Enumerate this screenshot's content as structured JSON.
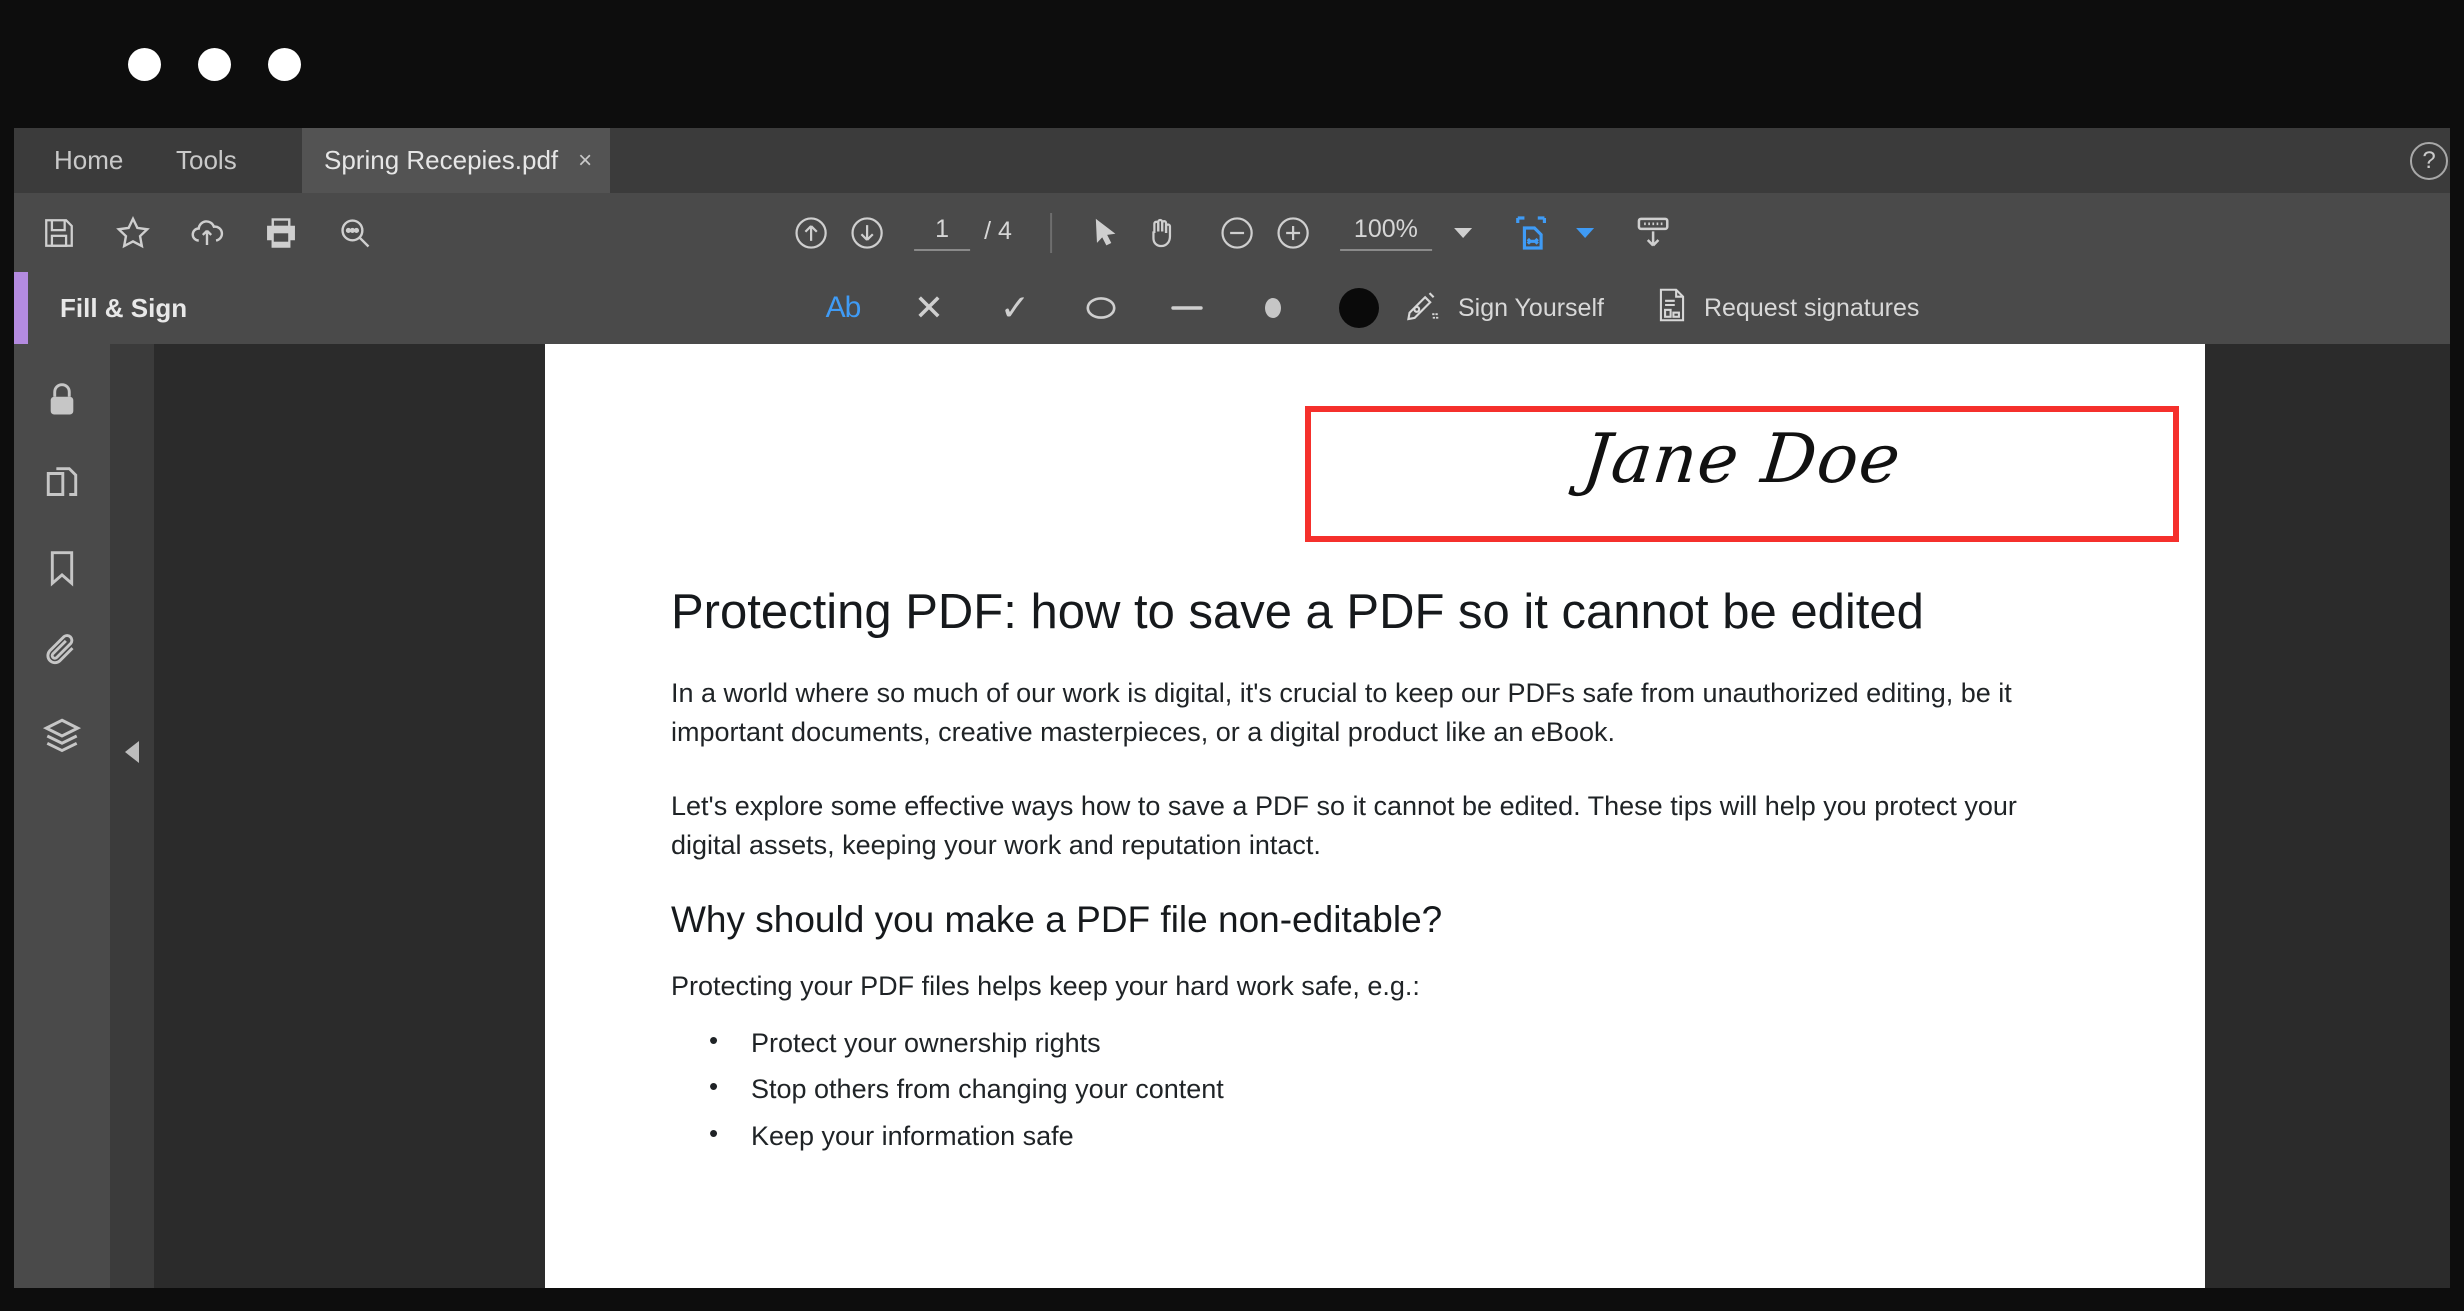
{
  "window": {
    "traffic_lights": [
      "close",
      "minimize",
      "maximize"
    ]
  },
  "tabs": {
    "home_label": "Home",
    "tools_label": "Tools",
    "document_label": "Spring Recepies.pdf",
    "close_glyph": "×",
    "help_glyph": "?"
  },
  "toolbar": {
    "icons": [
      {
        "name": "save-icon",
        "title": "Save"
      },
      {
        "name": "star-icon",
        "title": "Add to favorites"
      },
      {
        "name": "cloud-upload-icon",
        "title": "Upload to cloud"
      },
      {
        "name": "print-icon",
        "title": "Print"
      },
      {
        "name": "search-icon",
        "title": "Find"
      }
    ],
    "page_up_title": "Previous page",
    "page_down_title": "Next page",
    "page_current": "1",
    "page_total": "/ 4",
    "select_tool_title": "Select tool",
    "hand_tool_title": "Hand tool",
    "zoom_out_title": "Zoom out",
    "zoom_in_title": "Zoom in",
    "zoom_value": "100%",
    "fit_page_title": "Fit page width",
    "hide_toolbar_title": "Hide toolbar"
  },
  "fill_sign": {
    "title": "Fill & Sign",
    "text_tool_label": "Ab",
    "cross_glyph": "✕",
    "check_glyph": "✓",
    "ellipse_title": "Ellipse",
    "line_title": "Line",
    "dot_title": "Dot",
    "color_title": "Color",
    "sign_yourself_label": "Sign Yourself",
    "request_signatures_label": "Request signatures"
  },
  "sidebar": {
    "items": [
      {
        "name": "lock-icon",
        "label": "Protection"
      },
      {
        "name": "page-thumbnails-icon",
        "label": "Page thumbnails"
      },
      {
        "name": "bookmark-icon",
        "label": "Bookmarks"
      },
      {
        "name": "paperclip-icon",
        "label": "Attachments"
      },
      {
        "name": "layers-icon",
        "label": "Layers"
      }
    ],
    "collapse_title": "Collapse panel"
  },
  "document": {
    "signature_text": "Jane Doe",
    "signature_border_color": "#f5302c",
    "heading": "Protecting PDF: how to save a PDF so it cannot be edited",
    "paragraph_1": "In a world where so much of our work is digital, it's crucial to keep our PDFs safe from unauthorized editing, be it important documents, creative masterpieces, or a digital product like an eBook.",
    "paragraph_2": "Let's explore some effective ways how to save a PDF so it cannot be edited. These tips will help you protect your digital assets, keeping your work and reputation intact.",
    "subheading": "Why should you make a PDF file non-editable?",
    "paragraph_3": "Protecting your PDF files helps keep your hard work safe, e.g.:",
    "bullets": [
      "Protect your ownership rights",
      "Stop others from changing your content",
      "Keep your information safe"
    ]
  },
  "colors": {
    "accent_purple": "#b48be0",
    "accent_blue": "#3f9bf5",
    "signature_red": "#f5302c",
    "toolbar_bg": "#4a4a4a",
    "tabstrip_bg": "#3b3b3b"
  }
}
